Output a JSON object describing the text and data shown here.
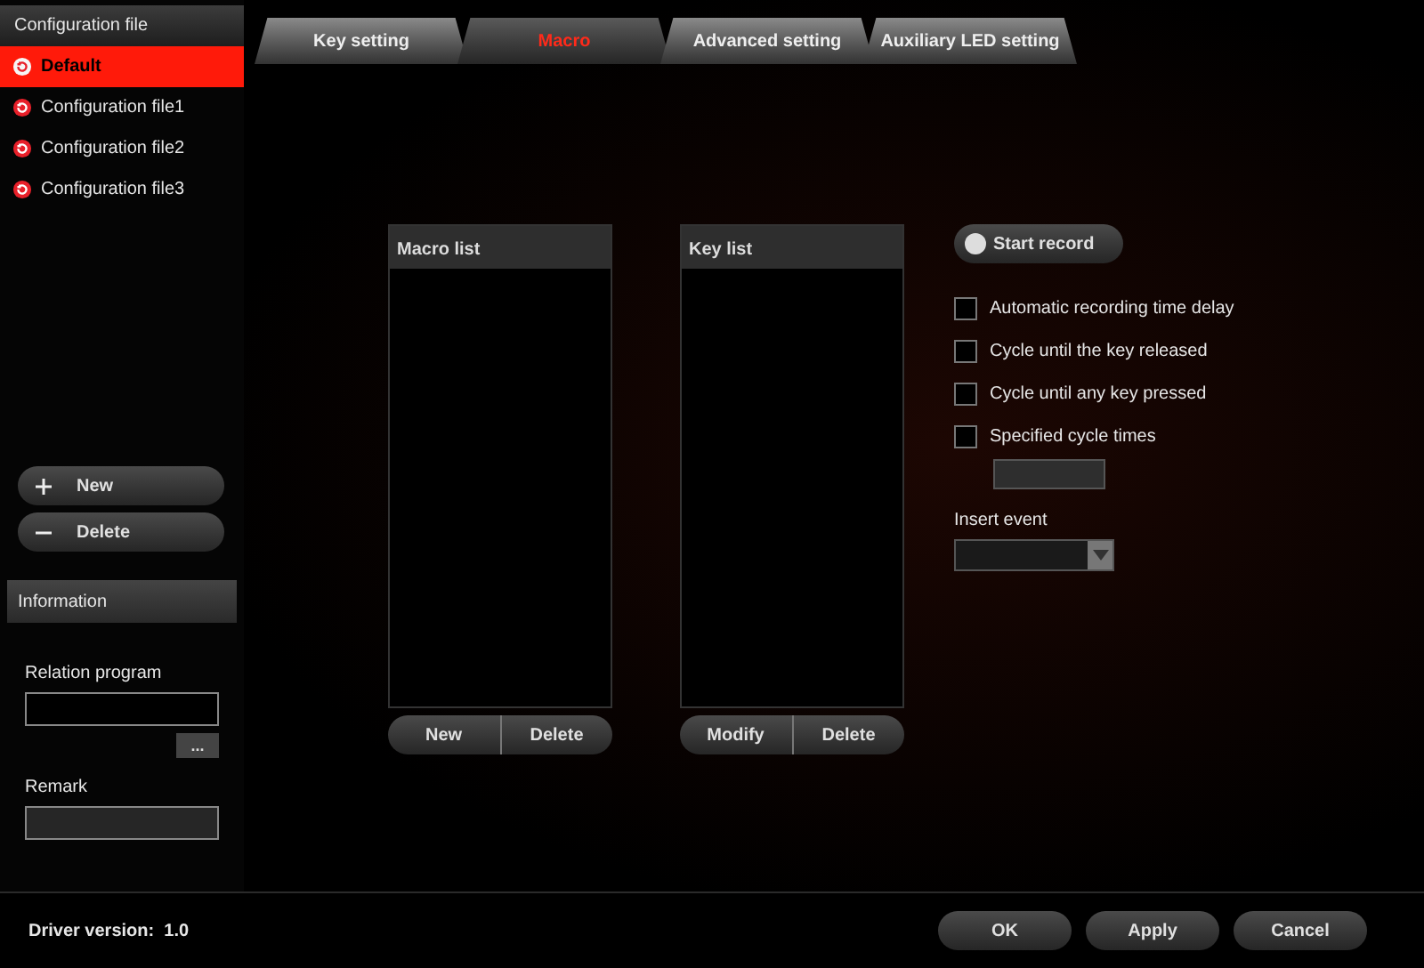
{
  "sidebar": {
    "title": "Configuration file",
    "profiles": [
      {
        "label": "Default",
        "selected": true
      },
      {
        "label": "Configuration file1",
        "selected": false
      },
      {
        "label": "Configuration file2",
        "selected": false
      },
      {
        "label": "Configuration file3",
        "selected": false
      }
    ],
    "actions": [
      {
        "kind": "add",
        "label": "New"
      },
      {
        "kind": "remove",
        "label": "Delete"
      }
    ],
    "information": {
      "title": "Information",
      "relation_label": "Relation program",
      "browse_label": "...",
      "remark_label": "Remark"
    }
  },
  "tabs": [
    {
      "label": "Key setting",
      "selected": false
    },
    {
      "label": "Macro",
      "selected": true
    },
    {
      "label": "Advanced setting",
      "selected": false
    },
    {
      "label": "Auxiliary LED setting",
      "selected": false
    }
  ],
  "macro_list": {
    "title": "Macro list",
    "buttons": [
      "New",
      "Delete"
    ]
  },
  "key_list": {
    "title": "Key list",
    "buttons": [
      "Modify",
      "Delete"
    ]
  },
  "record_button": "Start record",
  "options": [
    {
      "label": "Automatic recording time delay",
      "checked": false
    },
    {
      "label": "Cycle until the key released",
      "checked": false
    },
    {
      "label": "Cycle until any key pressed",
      "checked": false
    },
    {
      "label": "Specified cycle times",
      "checked": false
    }
  ],
  "insert_event_label": "Insert event",
  "driver_version": {
    "label": "Driver version:",
    "value": "1.0"
  },
  "footer_buttons": [
    "OK",
    "Apply",
    "Cancel"
  ]
}
